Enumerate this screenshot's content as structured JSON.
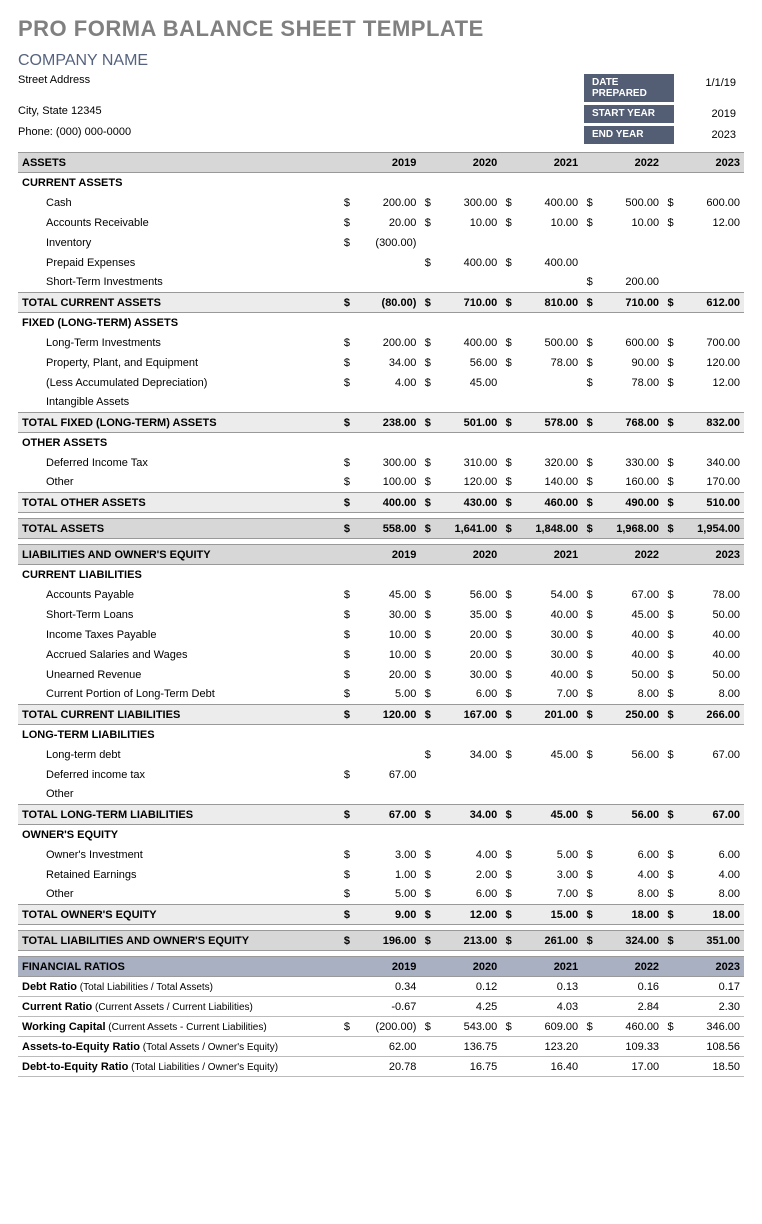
{
  "title": "PRO FORMA BALANCE SHEET TEMPLATE",
  "company": "COMPANY NAME",
  "addr1": "Street Address",
  "addr2": "City, State  12345",
  "phone": "Phone: (000) 000-0000",
  "meta": {
    "dp_l": "DATE PREPARED",
    "dp_v": "1/1/19",
    "sy_l": "START YEAR",
    "sy_v": "2019",
    "ey_l": "END YEAR",
    "ey_v": "2023"
  },
  "years": [
    "2019",
    "2020",
    "2021",
    "2022",
    "2023"
  ],
  "assets": {
    "hdr": "ASSETS",
    "cur": {
      "hdr": "CURRENT ASSETS",
      "rows": [
        {
          "l": "Cash",
          "v": [
            "200.00",
            "300.00",
            "400.00",
            "500.00",
            "600.00"
          ]
        },
        {
          "l": "Accounts Receivable",
          "v": [
            "20.00",
            "10.00",
            "10.00",
            "10.00",
            "12.00"
          ]
        },
        {
          "l": "Inventory",
          "v": [
            "(300.00)",
            "",
            "",
            "",
            ""
          ]
        },
        {
          "l": "Prepaid Expenses",
          "v": [
            "",
            "400.00",
            "400.00",
            "",
            ""
          ]
        },
        {
          "l": "Short-Term Investments",
          "v": [
            "",
            "",
            "",
            "200.00",
            ""
          ]
        }
      ],
      "tot": {
        "l": "TOTAL CURRENT ASSETS",
        "v": [
          "(80.00)",
          "710.00",
          "810.00",
          "710.00",
          "612.00"
        ]
      }
    },
    "fix": {
      "hdr": "FIXED (LONG-TERM) ASSETS",
      "rows": [
        {
          "l": "Long-Term Investments",
          "v": [
            "200.00",
            "400.00",
            "500.00",
            "600.00",
            "700.00"
          ]
        },
        {
          "l": "Property, Plant, and Equipment",
          "v": [
            "34.00",
            "56.00",
            "78.00",
            "90.00",
            "120.00"
          ]
        },
        {
          "l": "(Less Accumulated Depreciation)",
          "v": [
            "4.00",
            "45.00",
            "",
            "78.00",
            "12.00"
          ]
        },
        {
          "l": "Intangible Assets",
          "v": [
            "",
            "",
            "",
            "",
            ""
          ]
        }
      ],
      "tot": {
        "l": "TOTAL FIXED (LONG-TERM) ASSETS",
        "v": [
          "238.00",
          "501.00",
          "578.00",
          "768.00",
          "832.00"
        ]
      }
    },
    "oth": {
      "hdr": "OTHER ASSETS",
      "rows": [
        {
          "l": "Deferred Income Tax",
          "v": [
            "300.00",
            "310.00",
            "320.00",
            "330.00",
            "340.00"
          ]
        },
        {
          "l": "Other",
          "v": [
            "100.00",
            "120.00",
            "140.00",
            "160.00",
            "170.00"
          ]
        }
      ],
      "tot": {
        "l": "TOTAL OTHER ASSETS",
        "v": [
          "400.00",
          "430.00",
          "460.00",
          "490.00",
          "510.00"
        ]
      }
    },
    "grand": {
      "l": "TOTAL ASSETS",
      "v": [
        "558.00",
        "1,641.00",
        "1,848.00",
        "1,968.00",
        "1,954.00"
      ]
    }
  },
  "liab": {
    "hdr": "LIABILITIES AND OWNER'S EQUITY",
    "cur": {
      "hdr": "CURRENT LIABILITIES",
      "rows": [
        {
          "l": "Accounts Payable",
          "v": [
            "45.00",
            "56.00",
            "54.00",
            "67.00",
            "78.00"
          ]
        },
        {
          "l": "Short-Term Loans",
          "v": [
            "30.00",
            "35.00",
            "40.00",
            "45.00",
            "50.00"
          ]
        },
        {
          "l": "Income Taxes Payable",
          "v": [
            "10.00",
            "20.00",
            "30.00",
            "40.00",
            "40.00"
          ]
        },
        {
          "l": "Accrued Salaries and Wages",
          "v": [
            "10.00",
            "20.00",
            "30.00",
            "40.00",
            "40.00"
          ]
        },
        {
          "l": "Unearned Revenue",
          "v": [
            "20.00",
            "30.00",
            "40.00",
            "50.00",
            "50.00"
          ]
        },
        {
          "l": "Current Portion of Long-Term Debt",
          "v": [
            "5.00",
            "6.00",
            "7.00",
            "8.00",
            "8.00"
          ]
        }
      ],
      "tot": {
        "l": "TOTAL CURRENT LIABILITIES",
        "v": [
          "120.00",
          "167.00",
          "201.00",
          "250.00",
          "266.00"
        ]
      }
    },
    "lt": {
      "hdr": "LONG-TERM LIABILITIES",
      "rows": [
        {
          "l": "Long-term debt",
          "v": [
            "",
            "34.00",
            "45.00",
            "56.00",
            "67.00"
          ]
        },
        {
          "l": "Deferred income tax",
          "v": [
            "67.00",
            "",
            "",
            "",
            ""
          ]
        },
        {
          "l": "Other",
          "v": [
            "",
            "",
            "",
            "",
            ""
          ]
        }
      ],
      "tot": {
        "l": "TOTAL LONG-TERM LIABILITIES",
        "v": [
          "67.00",
          "34.00",
          "45.00",
          "56.00",
          "67.00"
        ]
      }
    },
    "eq": {
      "hdr": "OWNER'S EQUITY",
      "rows": [
        {
          "l": "Owner's Investment",
          "v": [
            "3.00",
            "4.00",
            "5.00",
            "6.00",
            "6.00"
          ]
        },
        {
          "l": "Retained Earnings",
          "v": [
            "1.00",
            "2.00",
            "3.00",
            "4.00",
            "4.00"
          ]
        },
        {
          "l": "Other",
          "v": [
            "5.00",
            "6.00",
            "7.00",
            "8.00",
            "8.00"
          ]
        }
      ],
      "tot": {
        "l": "TOTAL OWNER'S EQUITY",
        "v": [
          "9.00",
          "12.00",
          "15.00",
          "18.00",
          "18.00"
        ]
      }
    },
    "grand": {
      "l": "TOTAL LIABILITIES AND OWNER'S EQUITY",
      "v": [
        "196.00",
        "213.00",
        "261.00",
        "324.00",
        "351.00"
      ]
    }
  },
  "ratios": {
    "hdr": "FINANCIAL RATIOS",
    "rows": [
      {
        "n": "Debt Ratio",
        "d": " (Total Liabilities / Total Assets)",
        "dol": false,
        "v": [
          "0.34",
          "0.12",
          "0.13",
          "0.16",
          "0.17"
        ]
      },
      {
        "n": "Current Ratio",
        "d": " (Current Assets / Current Liabilities)",
        "dol": false,
        "v": [
          "-0.67",
          "4.25",
          "4.03",
          "2.84",
          "2.30"
        ]
      },
      {
        "n": "Working Capital",
        "d": " (Current Assets - Current Liabilities)",
        "dol": true,
        "v": [
          "(200.00)",
          "543.00",
          "609.00",
          "460.00",
          "346.00"
        ]
      },
      {
        "n": "Assets-to-Equity Ratio",
        "d": " (Total Assets / Owner's Equity)",
        "dol": false,
        "v": [
          "62.00",
          "136.75",
          "123.20",
          "109.33",
          "108.56"
        ]
      },
      {
        "n": "Debt-to-Equity Ratio",
        "d": " (Total Liabilities / Owner's Equity)",
        "dol": false,
        "v": [
          "20.78",
          "16.75",
          "16.40",
          "17.00",
          "18.50"
        ]
      }
    ]
  }
}
